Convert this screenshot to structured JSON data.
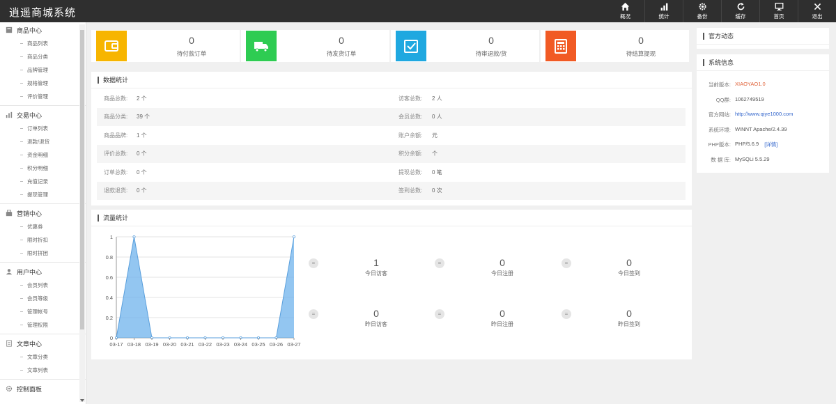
{
  "app": {
    "title": "逍遥商城系统"
  },
  "topnav": [
    {
      "label": "概况",
      "icon": "home-icon"
    },
    {
      "label": "统计",
      "icon": "bar-chart-icon"
    },
    {
      "label": "备份",
      "icon": "gear-icon"
    },
    {
      "label": "缓存",
      "icon": "refresh-icon"
    },
    {
      "label": "首页",
      "icon": "monitor-icon"
    },
    {
      "label": "退出",
      "icon": "close-icon"
    }
  ],
  "sidebar": {
    "sections": [
      {
        "title": "商品中心",
        "items": [
          "商品列表",
          "商品分类",
          "品牌管理",
          "规格管理",
          "评价管理"
        ]
      },
      {
        "title": "交易中心",
        "items": [
          "订单列表",
          "退款/退货",
          "资金明细",
          "积分明细",
          "充值记录",
          "提现管理"
        ]
      },
      {
        "title": "营销中心",
        "items": [
          "优惠券",
          "限时折扣",
          "限时拼团"
        ]
      },
      {
        "title": "用户中心",
        "items": [
          "会员列表",
          "会员等级",
          "管理帐号",
          "管理权限"
        ]
      },
      {
        "title": "文章中心",
        "items": [
          "文章分类",
          "文章列表"
        ]
      },
      {
        "title": "控制面板",
        "items": []
      }
    ]
  },
  "stats": [
    {
      "value": "0",
      "label": "待付款订单",
      "color": "#f7b500"
    },
    {
      "value": "0",
      "label": "待发货订单",
      "color": "#2ecc52"
    },
    {
      "value": "0",
      "label": "待审退款/货",
      "color": "#1fa8e0"
    },
    {
      "value": "0",
      "label": "待结算提现",
      "color": "#f15a24"
    }
  ],
  "data_stats": {
    "title": "数据统计",
    "rows": [
      {
        "lk": "商品总数:",
        "lv": "2 个",
        "rk": "访客总数:",
        "rv": "2 人"
      },
      {
        "lk": "商品分类:",
        "lv": "39 个",
        "rk": "会员总数:",
        "rv": "0 人"
      },
      {
        "lk": "商品品牌:",
        "lv": "1 个",
        "rk": "账户余额:",
        "rv": "元"
      },
      {
        "lk": "评价总数:",
        "lv": "0 个",
        "rk": "积分余额:",
        "rv": "个"
      },
      {
        "lk": "订单总数:",
        "lv": "0 个",
        "rk": "提现总数:",
        "rv": "0 笔"
      },
      {
        "lk": "退款退货:",
        "lv": "0 个",
        "rk": "签到总数:",
        "rv": "0 次"
      }
    ]
  },
  "traffic": {
    "title": "流量统计",
    "eq_symbol": "=",
    "items": [
      {
        "value": "1",
        "label": "今日访客"
      },
      {
        "value": "0",
        "label": "今日注册"
      },
      {
        "value": "0",
        "label": "今日签到"
      },
      {
        "value": "0",
        "label": "昨日访客"
      },
      {
        "value": "0",
        "label": "昨日注册"
      },
      {
        "value": "0",
        "label": "昨日签到"
      }
    ]
  },
  "chart_data": {
    "type": "area",
    "categories": [
      "03-17",
      "03-18",
      "03-19",
      "03-20",
      "03-21",
      "03-22",
      "03-23",
      "03-24",
      "03-25",
      "03-26",
      "03-27"
    ],
    "series": [
      {
        "values": [
          0,
          1,
          0,
          0,
          0,
          0,
          0,
          0,
          0,
          0,
          1
        ]
      }
    ],
    "ylim": [
      0,
      1
    ],
    "yticks": [
      "0",
      "0.2",
      "0.4",
      "0.6",
      "0.8",
      "1"
    ],
    "color": "#6fb3ec",
    "grid": true
  },
  "official": {
    "title": "官方动态"
  },
  "sysinfo": {
    "title": "系统信息",
    "rows": [
      {
        "k": "当前版本:",
        "v": "XIAOYAO1.0",
        "color": "#e0633a"
      },
      {
        "k": "QQ群:",
        "v": "1062749519"
      },
      {
        "k": "官方网站:",
        "v": "http://www.qiye1000.com",
        "color": "#3366cc"
      },
      {
        "k": "系统环境:",
        "v": "WINNT Apache/2.4.39"
      },
      {
        "k": "PHP版本:",
        "v": "PHP/5.6.9",
        "extra": "[详情]"
      },
      {
        "k": "数 据 库:",
        "v": "MySQLi 5.5.29"
      }
    ]
  }
}
